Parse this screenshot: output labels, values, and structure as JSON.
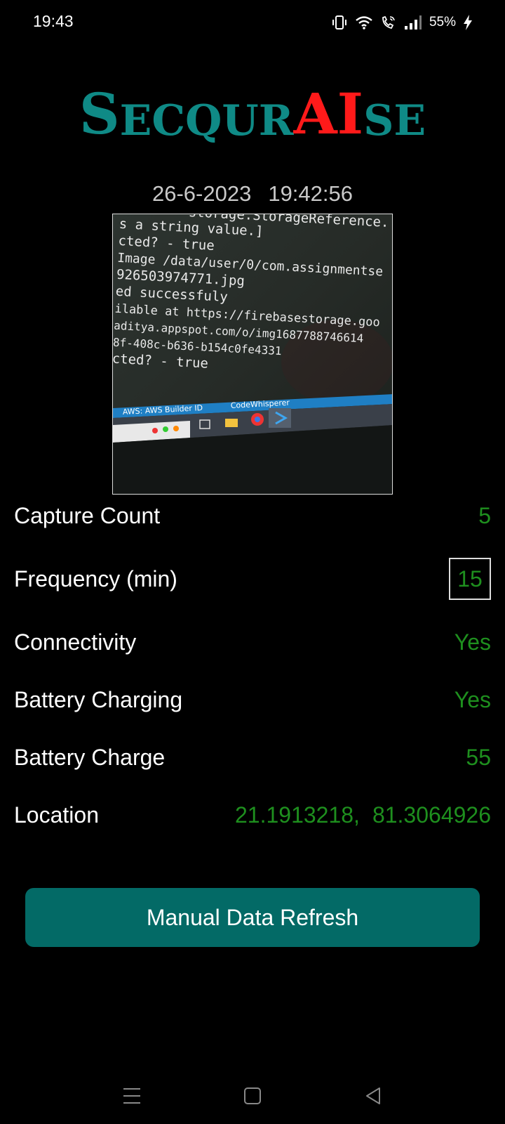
{
  "status_bar": {
    "time": "19:43",
    "battery_percent": "55%",
    "icons": [
      "vibrate-icon",
      "wifi-icon",
      "wifi-calling-icon",
      "signal-icon",
      "charging-bolt-icon"
    ]
  },
  "logo": {
    "parts": [
      "S",
      "ECQUR",
      "AI",
      "SE"
    ],
    "colors": {
      "teal": "#0f8a86",
      "red": "#ff1a1a"
    }
  },
  "capture": {
    "date": "26-6-2023",
    "time": "19:42:56",
    "image_lines": [
      "s a string value.]",
      "cted? -  true",
      "Image /data/user/0/com.assignmentse",
      "926503974771.jpg",
      "ed successfuly",
      "ilable at https://firebasestorage.goo",
      "aditya.appspot.com/o/img1687788746614",
      "8f-408c-b636-b154c0fe4331",
      "cted? -  true"
    ],
    "image_top_line": "storage.StorageReference.",
    "taskbar_text": [
      "AWS: AWS Builder ID",
      "CodeWhisperer"
    ]
  },
  "stats": {
    "capture_count": {
      "label": "Capture Count",
      "value": "5"
    },
    "frequency": {
      "label": "Frequency (min)",
      "value": "15"
    },
    "connectivity": {
      "label": "Connectivity",
      "value": "Yes"
    },
    "battery_charging": {
      "label": "Battery Charging",
      "value": "Yes"
    },
    "battery_charge": {
      "label": "Battery Charge",
      "value": "55"
    },
    "location": {
      "label": "Location",
      "lat": "21.1913218,",
      "lng": "81.3064926"
    }
  },
  "refresh_button": {
    "label": "Manual Data Refresh"
  },
  "nav": {
    "icons": [
      "menu-icon",
      "home-icon",
      "back-icon"
    ]
  },
  "colors": {
    "value_green": "#1e8f1e",
    "button_teal": "#036a66",
    "background": "#000000"
  }
}
